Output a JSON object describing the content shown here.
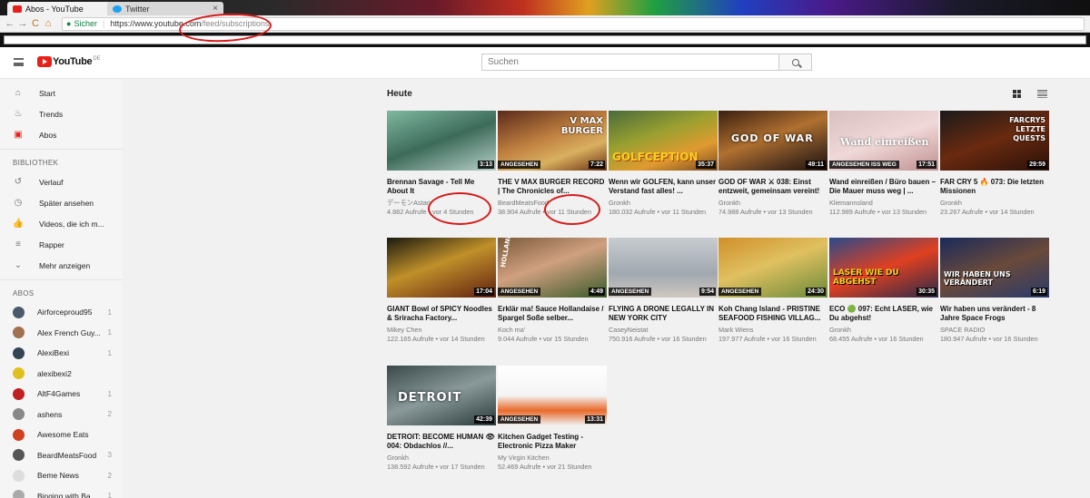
{
  "browser": {
    "tabs": [
      {
        "title": "Abos - YouTube",
        "fav_color": "#e62117"
      },
      {
        "title": "Twitter",
        "fav_color": "#1da1f2"
      }
    ],
    "tab_close": "×",
    "nav": {
      "back": "←",
      "forward": "→",
      "reload": "C",
      "home": "⌂"
    },
    "address": {
      "lock": "🔒",
      "secure_label": "Sicher",
      "host": "https://www.youtube.com",
      "path": "/feed/subscriptions"
    }
  },
  "header": {
    "logo_text": "YouTube",
    "logo_region": "DE",
    "search_placeholder": "Suchen"
  },
  "sidebar": {
    "nav": [
      {
        "label": "Start",
        "icon": "⌂"
      },
      {
        "label": "Trends",
        "icon": "♨"
      },
      {
        "label": "Abos",
        "icon": "▣"
      }
    ],
    "library_heading": "BIBLIOTHEK",
    "library": [
      {
        "label": "Verlauf",
        "icon": "↺"
      },
      {
        "label": "Später ansehen",
        "icon": "◷"
      },
      {
        "label": "Videos, die ich m...",
        "icon": "👍"
      },
      {
        "label": "Rapper",
        "icon": "≡"
      },
      {
        "label": "Mehr anzeigen",
        "icon": "⌄"
      }
    ],
    "subs_heading": "ABOS",
    "subscriptions": [
      {
        "name": "Airforceproud95",
        "count": "1",
        "color": "#4a5a6a"
      },
      {
        "name": "Alex French Guy...",
        "count": "1",
        "color": "#a07050"
      },
      {
        "name": "AlexiBexi",
        "count": "1",
        "color": "#334455"
      },
      {
        "name": "alexibexi2",
        "count": "",
        "color": "#e0c020"
      },
      {
        "name": "AltF4Games",
        "count": "1",
        "color": "#c02020"
      },
      {
        "name": "ashens",
        "count": "2",
        "color": "#888888"
      },
      {
        "name": "Awesome Eats",
        "count": "",
        "color": "#d04020"
      },
      {
        "name": "BeardMeatsFood",
        "count": "3",
        "color": "#555555"
      },
      {
        "name": "Beme News",
        "count": "2",
        "color": "#dddddd"
      },
      {
        "name": "Binging with Ba...",
        "count": "1",
        "color": "#aaaaaa"
      }
    ]
  },
  "main": {
    "section_title": "Heute",
    "videos": [
      {
        "title": "Brennan Savage - Tell Me About It",
        "channel": "デーモンAstari",
        "views": "4.882 Aufrufe",
        "age": "vor 4 Stunden",
        "duration": "3:13",
        "badge": "",
        "overlay": ""
      },
      {
        "title": "THE V MAX BURGER RECORD | The Chronicles of...",
        "channel": "BeardMeatsFood",
        "views": "38.904 Aufrufe",
        "age": "vor 11 Stunden",
        "duration": "7:22",
        "badge": "ANGESEHEN",
        "overlay": "V MAX BURGER"
      },
      {
        "title": "Wenn wir GOLFEN, kann unser Verstand fast alles! ...",
        "channel": "Gronkh",
        "views": "180.032 Aufrufe",
        "age": "vor 11 Stunden",
        "duration": "35:37",
        "badge": "",
        "overlay": "GOLFCEPTION"
      },
      {
        "title": "GOD OF WAR ⚔ 038: Einst entzweit, gemeinsam vereint!",
        "channel": "Gronkh",
        "views": "74.988 Aufrufe",
        "age": "vor 13 Stunden",
        "duration": "49:11",
        "badge": "",
        "overlay": "GOD OF WAR"
      },
      {
        "title": "Wand einreißen / Büro bauen – Die Mauer muss weg | ...",
        "channel": "Kliemannsland",
        "views": "112.989 Aufrufe",
        "age": "vor 13 Stunden",
        "duration": "17:51",
        "badge": "ANGESEHEN ISS WEG",
        "overlay": "Wand einreißen"
      },
      {
        "title": "FAR CRY 5 🔥 073: Die letzten Missionen",
        "channel": "Gronkh",
        "views": "23.267 Aufrufe",
        "age": "vor 14 Stunden",
        "duration": "29:59",
        "badge": "",
        "overlay": "FARCRY5 LETZTE QUESTS"
      },
      {
        "title": "GIANT Bowl of SPICY Noodles & Sriracha Factory...",
        "channel": "Mikey Chen",
        "views": "122.165 Aufrufe",
        "age": "vor 14 Stunden",
        "duration": "17:04",
        "badge": "",
        "overlay": ""
      },
      {
        "title": "Erklär ma! Sauce Hollandaise / Spargel Soße selber...",
        "channel": "Koch ma'",
        "views": "9.044 Aufrufe",
        "age": "vor 15 Stunden",
        "duration": "4:49",
        "badge": "ANGESEHEN",
        "overlay": "HOLLANDAISE"
      },
      {
        "title": "FLYING A DRONE LEGALLY IN NEW YORK CITY",
        "channel": "CaseyNeistat",
        "views": "750.916 Aufrufe",
        "age": "vor 16 Stunden",
        "duration": "9:54",
        "badge": "ANGESEHEN",
        "overlay": ""
      },
      {
        "title": "Koh Chang Island - PRISTINE SEAFOOD FISHING VILLAG...",
        "channel": "Mark Wiens",
        "views": "197.977 Aufrufe",
        "age": "vor 16 Stunden",
        "duration": "24:30",
        "badge": "ANGESEHEN",
        "overlay": ""
      },
      {
        "title": "ECO 🟢 097: Echt LASER, wie Du abgehst!",
        "channel": "Gronkh",
        "views": "68.455 Aufrufe",
        "age": "vor 16 Stunden",
        "duration": "30:35",
        "badge": "",
        "overlay": "LASER WIE DU ABGEHST"
      },
      {
        "title": "Wir haben uns verändert - 8 Jahre Space Frogs",
        "channel": "SPACE RADIO",
        "views": "180.947 Aufrufe",
        "age": "vor 16 Stunden",
        "duration": "6:19",
        "badge": "",
        "overlay": "WIR HABEN UNS VERÄNDERT"
      },
      {
        "title": "DETROIT: BECOME HUMAN 👁 004: Obdachlos //...",
        "channel": "Gronkh",
        "views": "138.592 Aufrufe",
        "age": "vor 17 Stunden",
        "duration": "42:39",
        "badge": "",
        "overlay": "DETROIT"
      },
      {
        "title": "Kitchen Gadget Testing - Electronic Pizza Maker",
        "channel": "My Virgin Kitchen",
        "views": "52.469 Aufrufe",
        "age": "vor 21 Stunden",
        "duration": "13:31",
        "badge": "ANGESEHEN",
        "overlay": ""
      }
    ]
  }
}
